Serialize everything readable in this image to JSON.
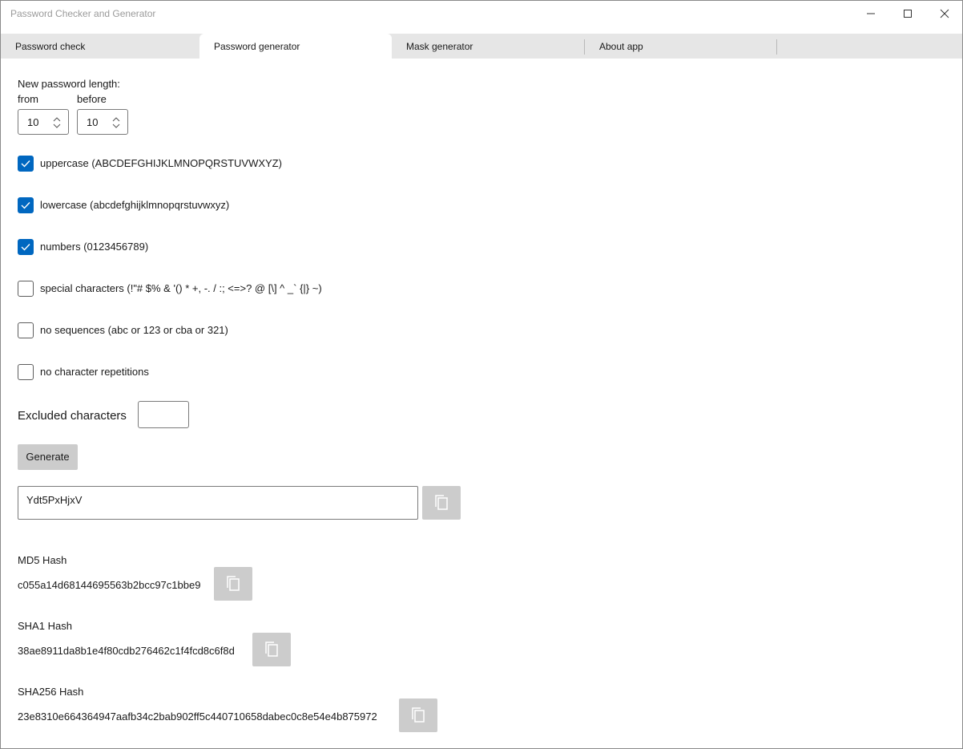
{
  "window": {
    "title": "Password Checker and Generator"
  },
  "tabs": [
    {
      "label": "Password check",
      "active": false
    },
    {
      "label": "Password generator",
      "active": true
    },
    {
      "label": "Mask generator",
      "active": false
    },
    {
      "label": "About app",
      "active": false
    }
  ],
  "length": {
    "heading": "New password length:",
    "from_label": "from",
    "before_label": "before",
    "from_value": "10",
    "before_value": "10"
  },
  "options": [
    {
      "label": "uppercase (ABCDEFGHIJKLMNOPQRSTUVWXYZ)",
      "checked": true
    },
    {
      "label": "lowercase (abcdefghijklmnopqrstuvwxyz)",
      "checked": true
    },
    {
      "label": "numbers (0123456789)",
      "checked": true
    },
    {
      "label": "special characters (!\"# $% & '() * +, -. / :; <=>? @ [\\] ^ _` {|} ~)",
      "checked": false
    },
    {
      "label": "no sequences (abc or 123 or cba or 321)",
      "checked": false
    },
    {
      "label": "no character repetitions",
      "checked": false
    }
  ],
  "excluded": {
    "label": "Excluded characters",
    "value": ""
  },
  "generate_label": "Generate",
  "password": "Ydt5PxHjxV",
  "hashes": [
    {
      "label": "MD5 Hash",
      "value": "c055a14d68144695563b2bcc97c1bbe9"
    },
    {
      "label": "SHA1 Hash",
      "value": "38ae8911da8b1e4f80cdb276462c1f4fcd8c6f8d"
    },
    {
      "label": "SHA256 Hash",
      "value": "23e8310e664364947aafb34c2bab902ff5c440710658dabec0c8e54e4b875972"
    }
  ],
  "colors": {
    "accent": "#0067c0",
    "tabbar": "#e6e6e6",
    "button": "#cccccc"
  },
  "icons": [
    "minimize-icon",
    "maximize-icon",
    "close-icon",
    "chevron-updown-icon",
    "checkmark-icon",
    "copy-icon"
  ]
}
